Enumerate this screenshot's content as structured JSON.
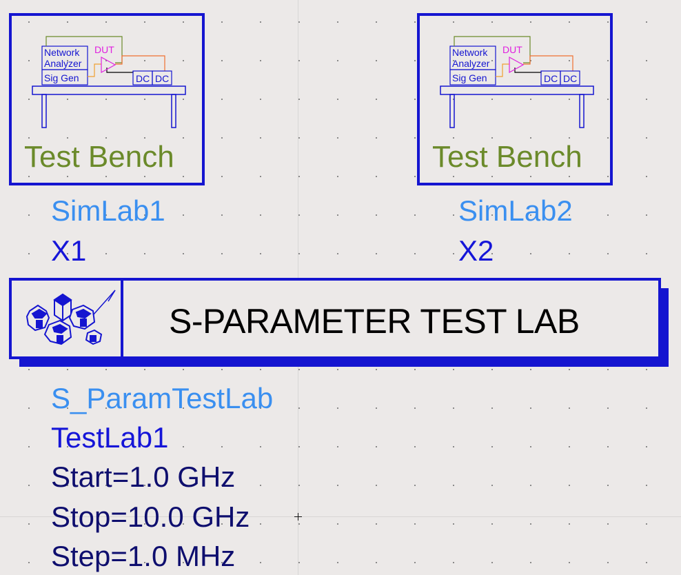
{
  "benches": [
    {
      "icon_text": {
        "network": "Network",
        "analyzer": "Analyzer",
        "dut": "DUT",
        "siggen": "Sig Gen",
        "dc1": "DC",
        "dc2": "DC"
      },
      "title": "Test Bench",
      "name": "SimLab1",
      "id": "X1"
    },
    {
      "icon_text": {
        "network": "Network",
        "analyzer": "Analyzer",
        "dut": "DUT",
        "siggen": "Sig Gen",
        "dc1": "DC",
        "dc2": "DC"
      },
      "title": "Test Bench",
      "name": "SimLab2",
      "id": "X2"
    }
  ],
  "lab": {
    "title": "S-PARAMETER TEST LAB",
    "icon": "gear-cluster-icon",
    "component": "S_ParamTestLab",
    "instance": "TestLab1",
    "params": [
      "Start=1.0 GHz",
      "Stop=10.0 GHz",
      "Step=1.0 MHz"
    ]
  },
  "colors": {
    "border": "#1515d0",
    "bench_title": "#6b8a2a",
    "component_name": "#3a8ff0",
    "instance_id": "#1515d8",
    "param_value": "#0e0e6e",
    "dut": "#e020e0"
  }
}
